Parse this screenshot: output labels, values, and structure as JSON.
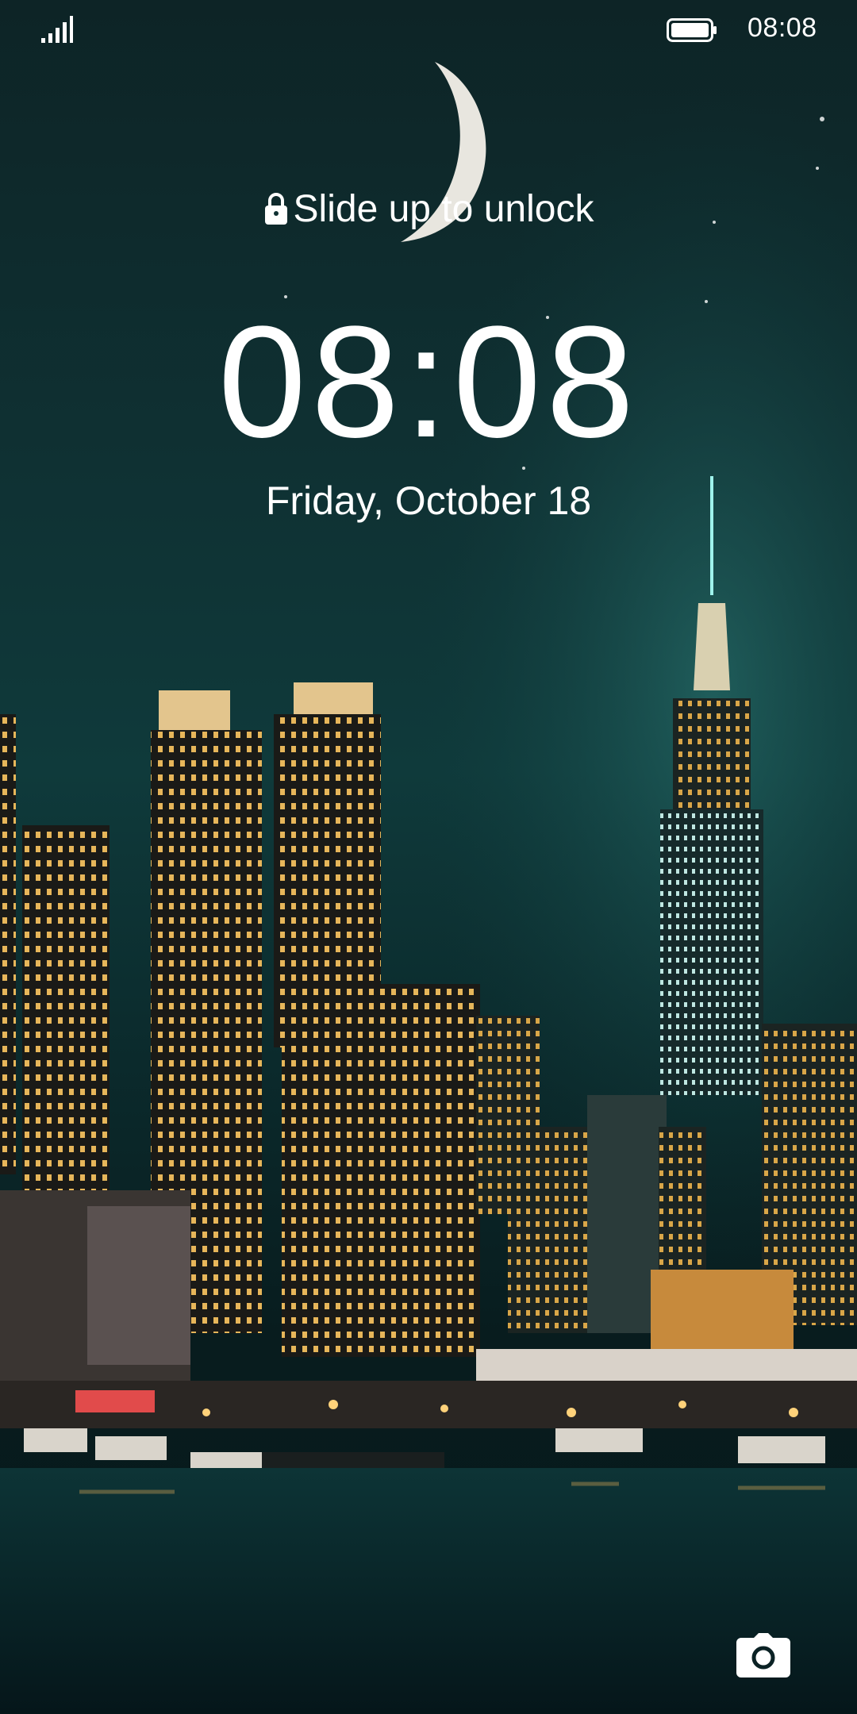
{
  "status_bar": {
    "time": "08:08",
    "signal_icon": "signal-bars-icon",
    "battery_icon": "battery-icon"
  },
  "lockscreen": {
    "unlock_hint": "Slide up to unlock",
    "lock_icon": "lock-icon",
    "clock": "08:08",
    "date": "Friday, October 18",
    "camera_icon": "camera-icon"
  },
  "wallpaper": {
    "description_colors": {
      "sky": "#0f3a3b",
      "water": "#06181a"
    }
  }
}
